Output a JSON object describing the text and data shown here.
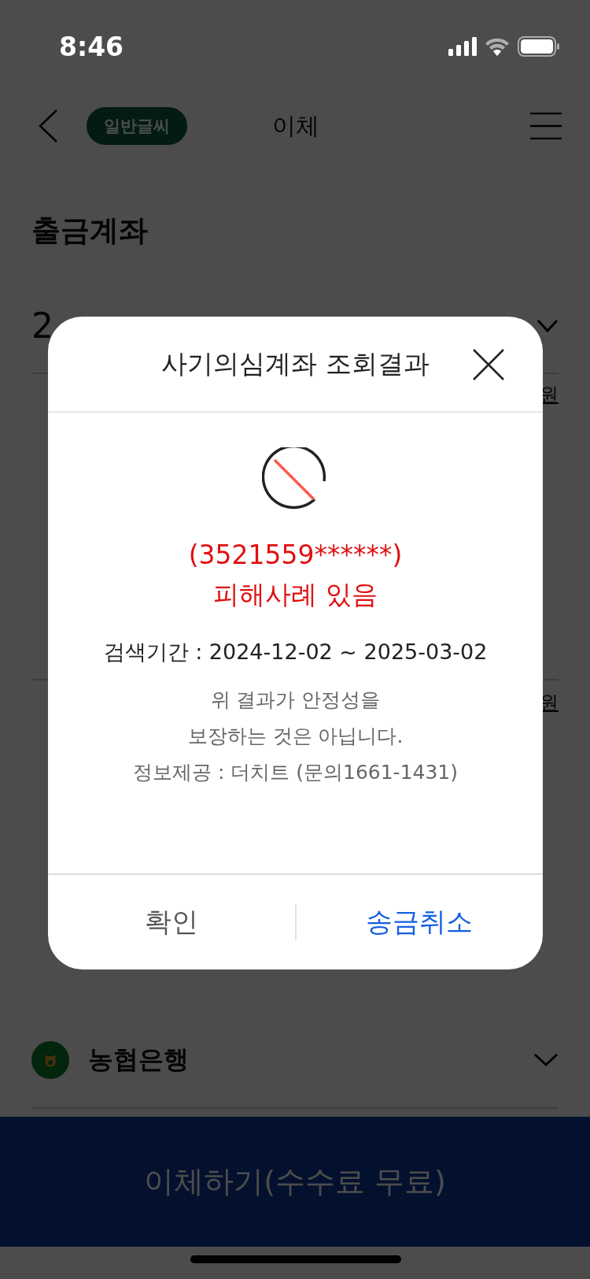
{
  "status_bar": {
    "time": "8:46"
  },
  "header": {
    "font_mode": "일반글씨",
    "title": "이체"
  },
  "section_title": "출금계좌",
  "account_fragment": "2",
  "won_marks": [
    "원",
    "원"
  ],
  "bank": {
    "name": "농협은행"
  },
  "submit_button": "이체하기(수수료 무료)",
  "modal": {
    "title": "사기의심계좌 조회결과",
    "account": "(3521559******)",
    "result": "피해사례 있음",
    "period": "검색기간 : 2024-12-02 ~ 2025-03-02",
    "notes": [
      "위 결과가 안정성을",
      "보장하는 것은 아닙니다.",
      "정보제공 : 더치트 (문의1661-1431)"
    ],
    "buttons": [
      {
        "label": "확인",
        "kind": "secondary"
      },
      {
        "label": "송금취소",
        "kind": "primary"
      }
    ]
  }
}
